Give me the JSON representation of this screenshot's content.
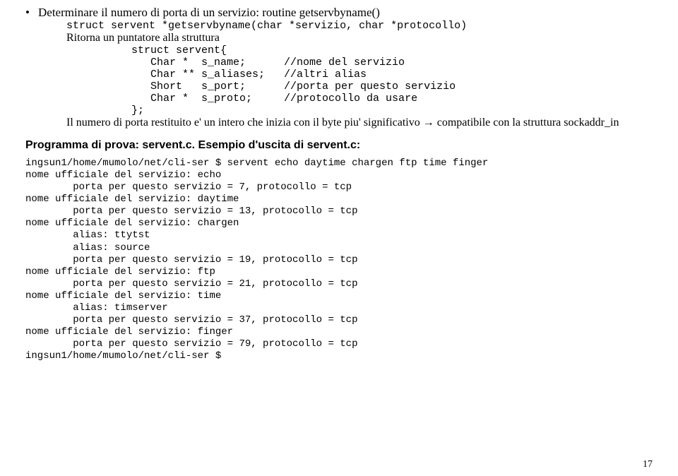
{
  "bullet_text": "Determinare il numero di porta di un servizio: routine getservbyname()",
  "decl": "struct servent *getservbyname(char *servizio, char *protocollo)",
  "return_text": "Ritorna un puntatore alla struttura",
  "struct_lines": [
    "struct servent{",
    "   Char *  s_name;      //nome del servizio",
    "   Char ** s_aliases;   //altri alias",
    "   Short   s_port;      //porta per questo servizio",
    "   Char *  s_proto;     //protocollo da usare",
    "};"
  ],
  "explain_prefix": "Il numero di porta restituito e' un intero che inizia con il byte piu' significativo ",
  "arrow": "→",
  "explain_suffix": " compatibile con la struttura sockaddr_in",
  "prog_title": "Programma di prova: servent.c. Esempio d'uscita di servent.c:",
  "output_lines": [
    "ingsun1/home/mumolo/net/cli-ser $ servent echo daytime chargen ftp time finger",
    "nome ufficiale del servizio: echo",
    "        porta per questo servizio = 7, protocollo = tcp",
    "nome ufficiale del servizio: daytime",
    "        porta per questo servizio = 13, protocollo = tcp",
    "nome ufficiale del servizio: chargen",
    "        alias: ttytst",
    "        alias: source",
    "        porta per questo servizio = 19, protocollo = tcp",
    "nome ufficiale del servizio: ftp",
    "        porta per questo servizio = 21, protocollo = tcp",
    "nome ufficiale del servizio: time",
    "        alias: timserver",
    "        porta per questo servizio = 37, protocollo = tcp",
    "nome ufficiale del servizio: finger",
    "        porta per questo servizio = 79, protocollo = tcp",
    "ingsun1/home/mumolo/net/cli-ser $"
  ],
  "pagenum": "17"
}
